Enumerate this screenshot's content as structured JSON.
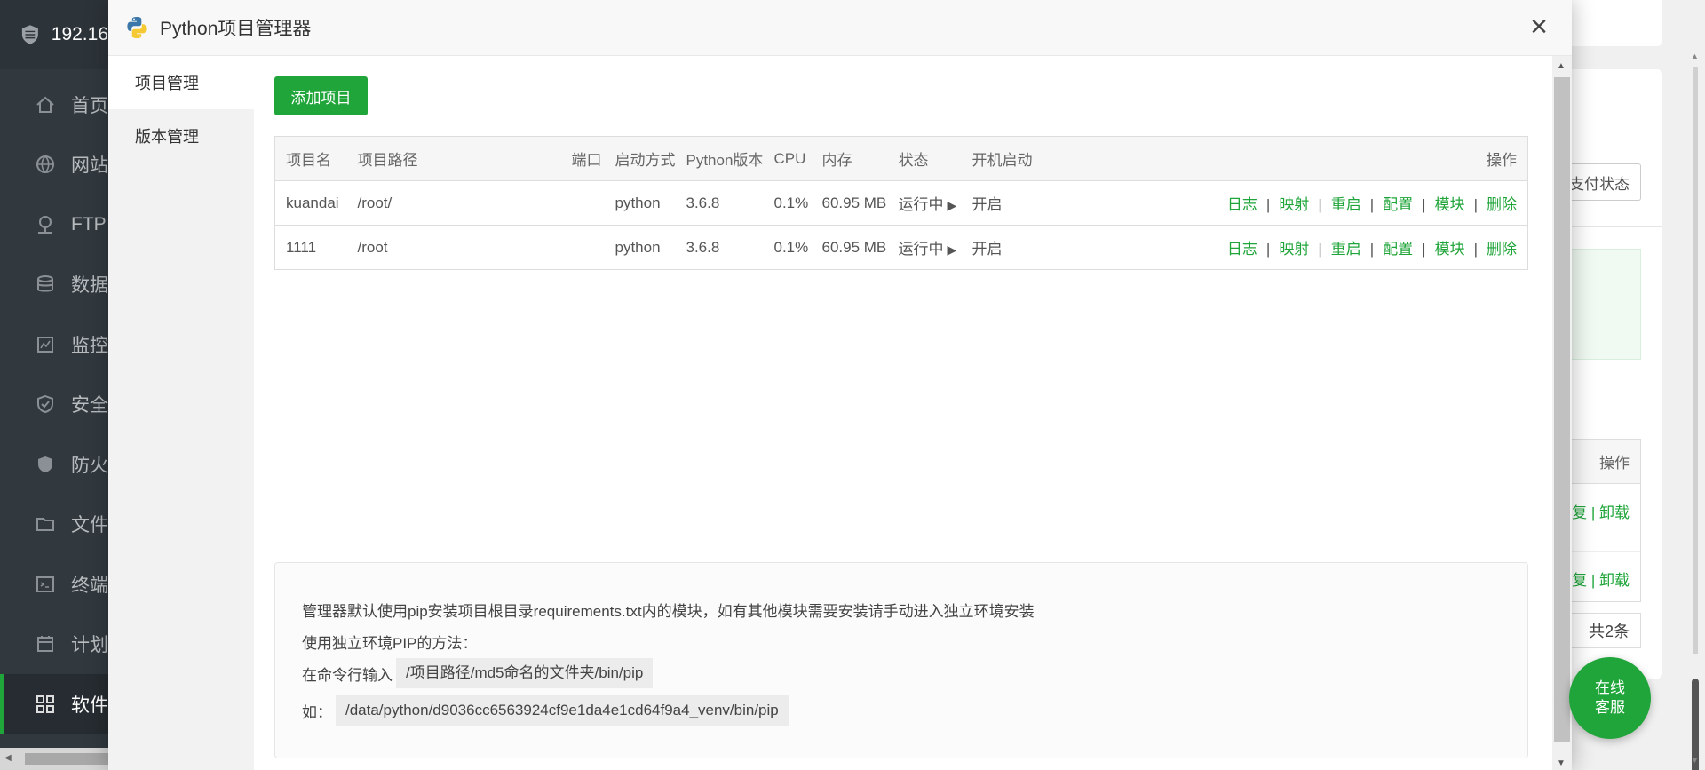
{
  "background": {
    "brand_text": "192.16",
    "nav": [
      {
        "label": "首页",
        "icon": "home-icon"
      },
      {
        "label": "网站",
        "icon": "globe-icon"
      },
      {
        "label": "FTP",
        "icon": "ftp-icon"
      },
      {
        "label": "数据",
        "icon": "database-icon"
      },
      {
        "label": "监控",
        "icon": "monitor-icon"
      },
      {
        "label": "安全",
        "icon": "shield-check-icon"
      },
      {
        "label": "防火",
        "icon": "firewall-icon"
      },
      {
        "label": "文件",
        "icon": "folder-icon"
      },
      {
        "label": "终端",
        "icon": "terminal-icon"
      },
      {
        "label": "计划",
        "icon": "calendar-icon"
      },
      {
        "label": "软件",
        "icon": "grid-icon"
      }
    ],
    "right_button": "支付状态",
    "right_table_header": "操作",
    "right_rows": [
      "复 | 卸载",
      "复 | 卸载"
    ],
    "right_total": "共2条"
  },
  "online_service": {
    "line1": "在线",
    "line2": "客服"
  },
  "modal": {
    "title": "Python项目管理器",
    "close": "×",
    "side": [
      "项目管理",
      "版本管理"
    ],
    "add_button": "添加项目",
    "table": {
      "headers": [
        "项目名",
        "项目路径",
        "端口",
        "启动方式",
        "Python版本",
        "CPU",
        "内存",
        "状态",
        "开机启动",
        "操作"
      ],
      "rows": [
        {
          "name": "kuandai",
          "path": "/root/",
          "port": "",
          "start": "python",
          "version": "3.6.8",
          "cpu": "0.1%",
          "mem": "60.95 MB",
          "status": "运行中",
          "boot": "开启"
        },
        {
          "name": "1111",
          "path": "/root",
          "port": "",
          "start": "python",
          "version": "3.6.8",
          "cpu": "0.1%",
          "mem": "60.95 MB",
          "status": "运行中",
          "boot": "开启"
        }
      ],
      "ops": [
        "日志",
        "映射",
        "重启",
        "配置",
        "模块",
        "删除"
      ]
    },
    "info": {
      "line1": "管理器默认使用pip安装项目根目录requirements.txt内的模块，如有其他模块需要安装请手动进入独立环境安装",
      "line2": "使用独立环境PIP的方法：",
      "line3_label": "在命令行输入",
      "line3_code": "/项目路径/md5命名的文件夹/bin/pip",
      "line4_label": "如：",
      "line4_code": "/data/python/d9036cc6563924cf9e1da4e1cd64f9a4_venv/bin/pip"
    }
  }
}
